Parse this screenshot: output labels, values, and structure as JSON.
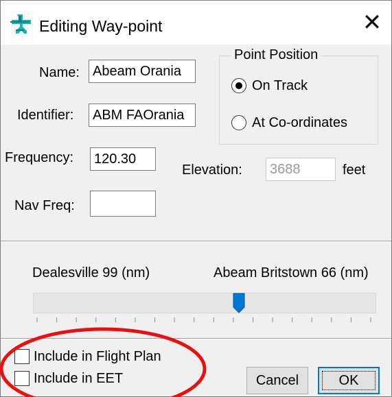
{
  "window": {
    "title": "Editing Way-point",
    "icon": "aircraft-waypoint-icon",
    "close_glyph": "✕"
  },
  "fields": {
    "name": {
      "label": "Name:",
      "value": "Abeam Orania"
    },
    "identifier": {
      "label": "Identifier:",
      "value": "ABM FAOrania"
    },
    "frequency": {
      "label": "Frequency:",
      "value": "120.30"
    },
    "nav_freq": {
      "label": "Nav Freq:",
      "value": ""
    },
    "elevation": {
      "label": "Elevation:",
      "value": "3688",
      "unit": "feet"
    }
  },
  "point_position": {
    "title": "Point Position",
    "options": [
      {
        "label": "On Track",
        "checked": true
      },
      {
        "label": "At Co-ordinates",
        "checked": false
      }
    ]
  },
  "slider": {
    "left_label": "Dealesville 99 (nm)",
    "right_label": "Abeam Britstown 66 (nm)",
    "position_fraction": 0.6
  },
  "checkboxes": [
    {
      "label": "Include in Flight Plan",
      "checked": false
    },
    {
      "label": "Include in EET",
      "checked": false
    }
  ],
  "buttons": {
    "cancel": "Cancel",
    "ok": "OK"
  },
  "colors": {
    "accent": "#0078d7",
    "annotation": "#e81010"
  }
}
